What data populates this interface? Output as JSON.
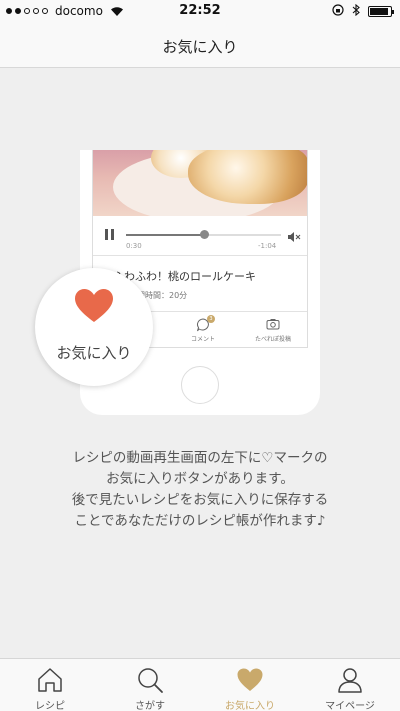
{
  "status_bar": {
    "carrier": "docomo",
    "time": "22:52"
  },
  "nav": {
    "title": "お気に入り"
  },
  "illustration": {
    "player": {
      "current_time": "0:30",
      "remaining_time": "-1:04"
    },
    "recipe_title": "ふわふわ！桃のロールケーキ",
    "recipe_time": "調理時間：20分",
    "mini_tabs": [
      {
        "label": "コメント",
        "badge": "3",
        "icon": "comment-icon"
      },
      {
        "label": "たべれぽ投稿",
        "icon": "camera-icon"
      }
    ],
    "callout_label": "お気に入り",
    "heart_color": "#e8694a"
  },
  "description": [
    "レシピの動画再生画面の左下に♡マークの",
    "お気に入りボタンがあります。",
    "後で見たいレシピをお気に入りに保存する",
    "ことであなただけのレシピ帳が作れます♪"
  ],
  "tabs": [
    {
      "label": "レシピ",
      "icon": "home-icon",
      "active": false
    },
    {
      "label": "さがす",
      "icon": "search-icon",
      "active": false
    },
    {
      "label": "お気に入り",
      "icon": "heart-icon",
      "active": true
    },
    {
      "label": "マイページ",
      "icon": "person-icon",
      "active": false
    }
  ],
  "colors": {
    "accent": "#c9a96b",
    "heart": "#e8694a",
    "background": "#efefef"
  }
}
